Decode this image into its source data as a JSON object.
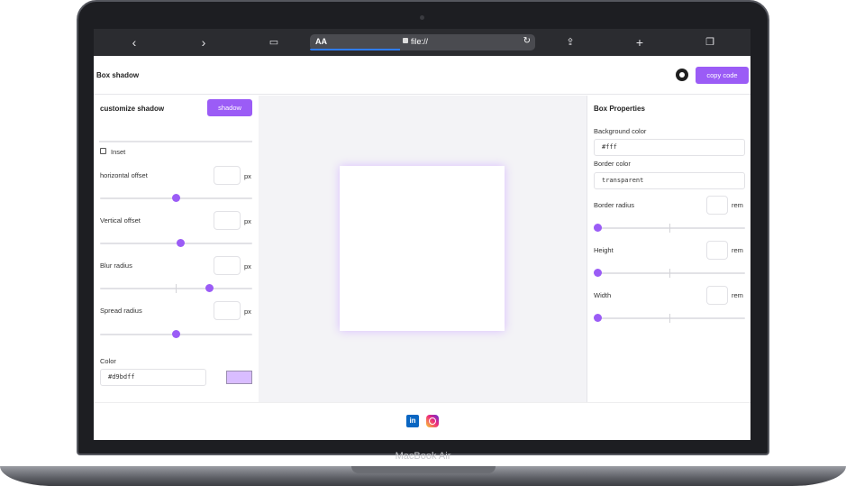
{
  "device": {
    "brand": "MacBook Air"
  },
  "browser": {
    "url_prefix": "AA",
    "url": "file://",
    "icons": [
      "back-icon",
      "forward-icon",
      "book-icon",
      "lock-icon",
      "reload-icon",
      "share-icon",
      "plus-icon",
      "tabs-icon"
    ]
  },
  "header": {
    "title": "Box shadow",
    "copy_label": "copy code",
    "github_icon": "github-icon"
  },
  "left": {
    "title": "customize shadow",
    "shadow_button": "shadow",
    "inset_label": "Inset",
    "inset_checked": false,
    "controls": [
      {
        "label": "horizontal offset",
        "unit": "px",
        "slider_fraction": 0.5
      },
      {
        "label": "Vertical offset",
        "unit": "px",
        "slider_fraction": 0.53
      },
      {
        "label": "Blur radius",
        "unit": "px",
        "slider_fraction": 0.72
      },
      {
        "label": "Spread radius",
        "unit": "px",
        "slider_fraction": 0.5
      }
    ],
    "color_label": "Color",
    "color_value": "#d9bdff",
    "swatch_color": "#d9bdff"
  },
  "right": {
    "title": "Box Properties",
    "background_label": "Background color",
    "background_value": "#fff",
    "border_color_label": "Border color",
    "border_color_value": "transparent",
    "controls": [
      {
        "label": "Border radius",
        "unit": "rem",
        "slider_fraction": 0.0
      },
      {
        "label": "Height",
        "unit": "rem",
        "slider_fraction": 0.0
      },
      {
        "label": "Width",
        "unit": "rem",
        "slider_fraction": 0.0
      }
    ]
  },
  "colors": {
    "accent": "#9b5cf6",
    "shadow": "#d9bdff",
    "preview_bg": "#f3f3f6"
  },
  "footer": {
    "icons": [
      "linkedin-icon",
      "instagram-icon"
    ]
  }
}
